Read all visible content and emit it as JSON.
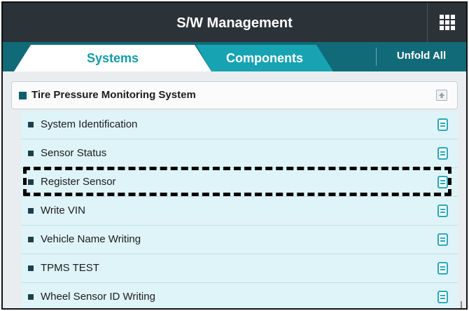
{
  "header": {
    "title": "S/W Management",
    "menu_icon": "grid-menu-icon"
  },
  "tabs": {
    "systems_label": "Systems",
    "components_label": "Components",
    "unfold_label": "Unfold All"
  },
  "system": {
    "title": "Tire Pressure Monitoring System"
  },
  "items": [
    {
      "label": "System Identification"
    },
    {
      "label": "Sensor Status"
    },
    {
      "label": "Register Sensor",
      "highlighted": true
    },
    {
      "label": "Write VIN"
    },
    {
      "label": "Vehicle Name Writing"
    },
    {
      "label": "TPMS TEST"
    },
    {
      "label": "Wheel Sensor ID Writing"
    }
  ],
  "colors": {
    "header_bg": "#2b3238",
    "tab_bar_bg": "#116a78",
    "tab_active_text": "#129baa",
    "tab_inactive_bg": "#18a3b3",
    "item_bg": "#dff4f8",
    "doc_icon": "#27a9bb"
  }
}
